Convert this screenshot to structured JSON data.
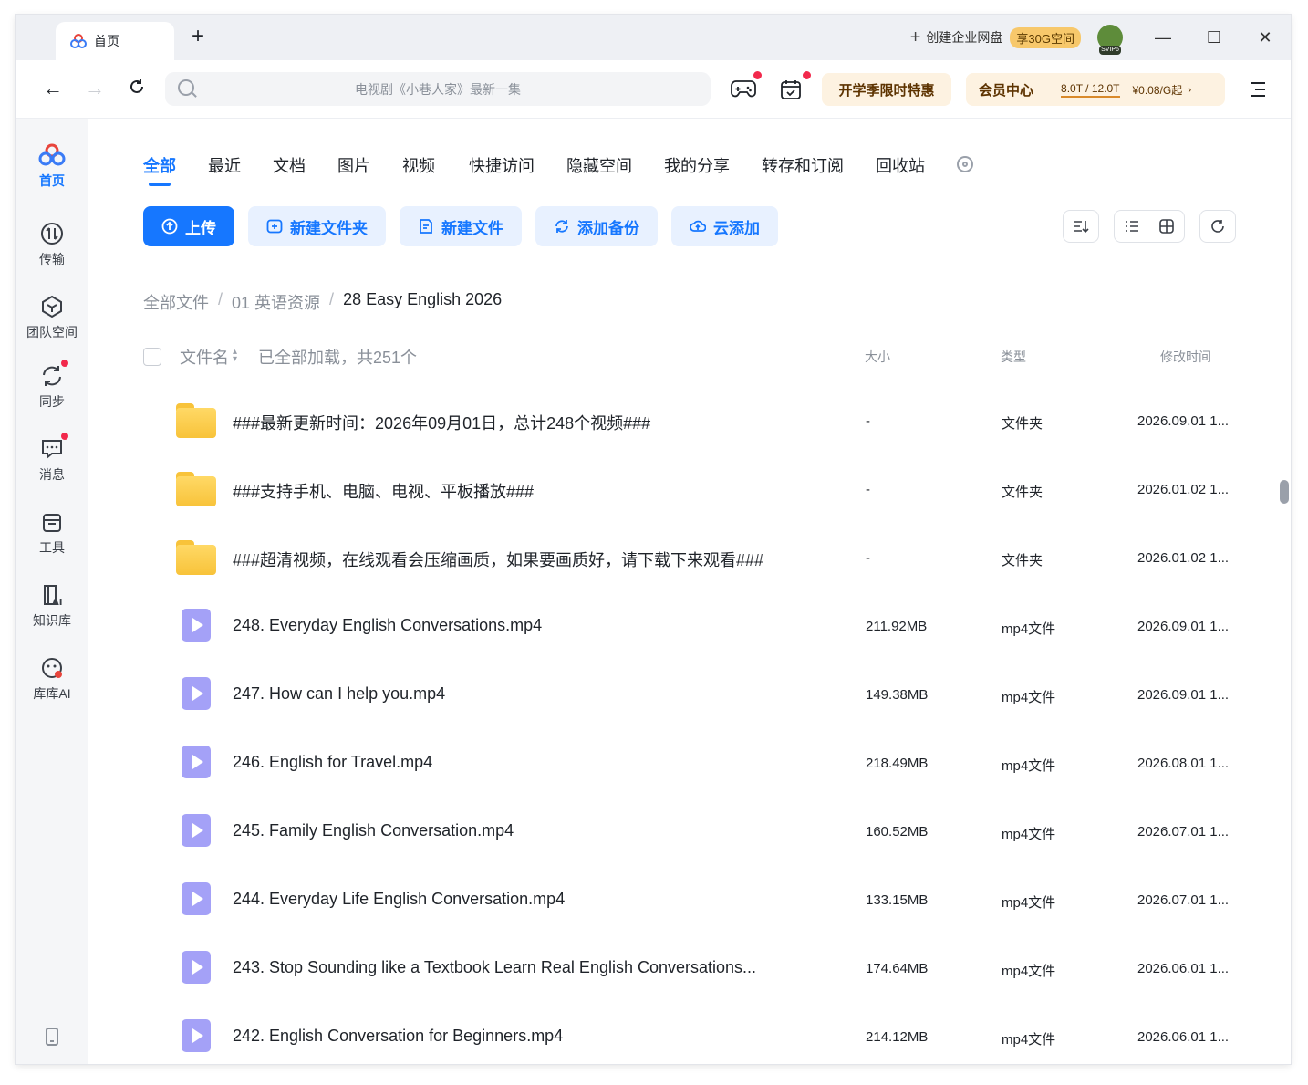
{
  "titlebar": {
    "tab_label": "首页",
    "create_enterprise": "创建企业网盘",
    "space_badge": "享30G空间",
    "avatar_level": "SVIP6"
  },
  "toolbar": {
    "search_placeholder": "电视剧《小巷人家》最新一集",
    "promo_label": "开学季限时特惠",
    "vip_label": "会员中心",
    "quota": "8.0T / 12.0T",
    "price": "¥0.08/G起"
  },
  "sidebar": {
    "items": [
      {
        "label": "首页"
      },
      {
        "label": "传输"
      },
      {
        "label": "团队空间"
      },
      {
        "label": "同步"
      },
      {
        "label": "消息"
      },
      {
        "label": "工具"
      },
      {
        "label": "知识库"
      },
      {
        "label": "库库AI"
      }
    ]
  },
  "tabs": [
    "全部",
    "最近",
    "文档",
    "图片",
    "视频",
    "快捷访问",
    "隐藏空间",
    "我的分享",
    "转存和订阅",
    "回收站"
  ],
  "actions": {
    "upload": "上传",
    "new_folder": "新建文件夹",
    "new_file": "新建文件",
    "add_backup": "添加备份",
    "cloud_add": "云添加"
  },
  "breadcrumb": {
    "root": "全部文件",
    "level1": "01 英语资源",
    "current": "28 Easy English 2026",
    "separator": "/"
  },
  "list_header": {
    "name": "文件名",
    "loaded": "已全部加载，共251个",
    "size": "大小",
    "type": "类型",
    "time": "修改时间"
  },
  "files": [
    {
      "kind": "folder",
      "name": "###最新更新时间：2026年09月01日，总计248个视频###",
      "size": "-",
      "type": "文件夹",
      "time": "2026.09.01 1..."
    },
    {
      "kind": "folder",
      "name": "###支持手机、电脑、电视、平板播放###",
      "size": "-",
      "type": "文件夹",
      "time": "2026.01.02 1..."
    },
    {
      "kind": "folder",
      "name": "###超清视频，在线观看会压缩画质，如果要画质好，请下载下来观看###",
      "size": "-",
      "type": "文件夹",
      "time": "2026.01.02 1..."
    },
    {
      "kind": "video",
      "name": "248. Everyday English Conversations.mp4",
      "size": "211.92MB",
      "type": "mp4文件",
      "time": "2026.09.01 1..."
    },
    {
      "kind": "video",
      "name": "247. How can I help you.mp4",
      "size": "149.38MB",
      "type": "mp4文件",
      "time": "2026.09.01 1..."
    },
    {
      "kind": "video",
      "name": "246. English for Travel.mp4",
      "size": "218.49MB",
      "type": "mp4文件",
      "time": "2026.08.01 1..."
    },
    {
      "kind": "video",
      "name": "245. Family English Conversation.mp4",
      "size": "160.52MB",
      "type": "mp4文件",
      "time": "2026.07.01 1..."
    },
    {
      "kind": "video",
      "name": "244. Everyday Life English Conversation.mp4",
      "size": "133.15MB",
      "type": "mp4文件",
      "time": "2026.07.01 1..."
    },
    {
      "kind": "video",
      "name": "243. Stop Sounding like a Textbook Learn Real English Conversations...",
      "size": "174.64MB",
      "type": "mp4文件",
      "time": "2026.06.01 1..."
    },
    {
      "kind": "video",
      "name": "242. English Conversation for Beginners.mp4",
      "size": "214.12MB",
      "type": "mp4文件",
      "time": "2026.06.01 1..."
    }
  ],
  "colors": {
    "accent": "#1677ff",
    "folder": "#f8c33a",
    "video": "#a4a1f7",
    "notification_dot": "#f2294c"
  }
}
